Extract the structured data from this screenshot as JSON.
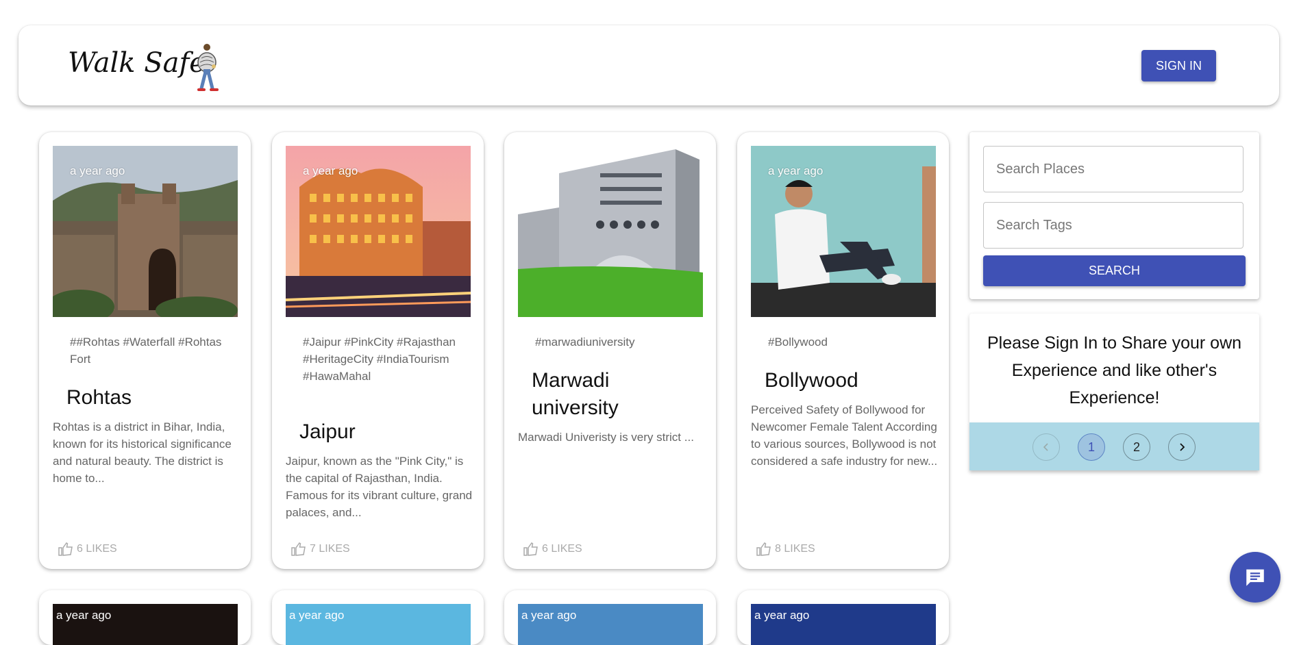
{
  "header": {
    "brand": "Walk Safe",
    "signin_label": "SIGN IN"
  },
  "posts": [
    {
      "time": "a year ago",
      "tags": "##Rohtas #Waterfall #Rohtas Fort",
      "title": "Rohtas",
      "desc": "Rohtas is a district in Bihar, India, known for its historical significance and natural beauty. The district is home to...",
      "likes": "6 LIKES"
    },
    {
      "time": "a year ago",
      "tags": "#Jaipur #PinkCity #Rajasthan #HeritageCity #IndiaTourism #HawaMahal",
      "title": "Jaipur",
      "desc": "Jaipur, known as the \"Pink City,\" is the capital of Rajasthan, India. Famous for its vibrant culture, grand palaces, and...",
      "likes": "7 LIKES"
    },
    {
      "time": "",
      "tags": "#marwadiuniversity",
      "title": "Marwadi university",
      "desc": "Marwadi Univeristy is very strict ...",
      "likes": "6 LIKES"
    },
    {
      "time": "a year ago",
      "tags": "#Bollywood",
      "title": "Bollywood",
      "desc": "Perceived Safety of Bollywood for Newcomer Female Talent According to various sources, Bollywood is not considered a safe industry for new...",
      "likes": "8 LIKES"
    }
  ],
  "next_row": [
    {
      "time": "a year ago"
    },
    {
      "time": "a year ago"
    },
    {
      "time": "a year ago"
    },
    {
      "time": "a year ago"
    }
  ],
  "search": {
    "places_placeholder": "Search Places",
    "tags_placeholder": "Search Tags",
    "button_label": "SEARCH"
  },
  "info": {
    "message": "Please Sign In to Share your own Experience and like other's Experience!"
  },
  "pagination": {
    "pages": [
      "1",
      "2"
    ],
    "current": "1",
    "prev_icon": "chevron-left-icon",
    "next_icon": "chevron-right-icon"
  },
  "colors": {
    "primary": "#3f51b5",
    "pager_bg": "#add8e6"
  }
}
